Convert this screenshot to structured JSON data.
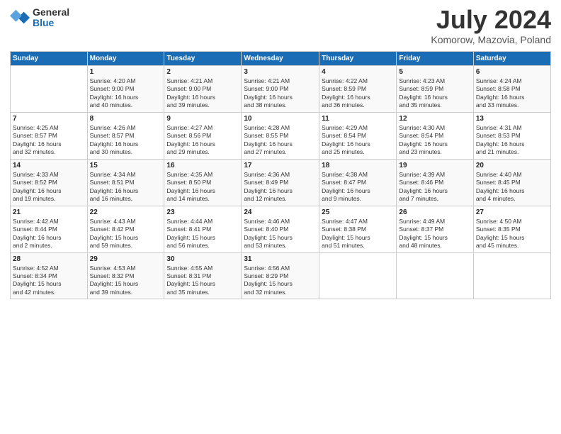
{
  "logo": {
    "general": "General",
    "blue": "Blue"
  },
  "header": {
    "month": "July 2024",
    "location": "Komorow, Mazovia, Poland"
  },
  "weekdays": [
    "Sunday",
    "Monday",
    "Tuesday",
    "Wednesday",
    "Thursday",
    "Friday",
    "Saturday"
  ],
  "weeks": [
    [
      {
        "day": "",
        "info": ""
      },
      {
        "day": "1",
        "info": "Sunrise: 4:20 AM\nSunset: 9:00 PM\nDaylight: 16 hours\nand 40 minutes."
      },
      {
        "day": "2",
        "info": "Sunrise: 4:21 AM\nSunset: 9:00 PM\nDaylight: 16 hours\nand 39 minutes."
      },
      {
        "day": "3",
        "info": "Sunrise: 4:21 AM\nSunset: 9:00 PM\nDaylight: 16 hours\nand 38 minutes."
      },
      {
        "day": "4",
        "info": "Sunrise: 4:22 AM\nSunset: 8:59 PM\nDaylight: 16 hours\nand 36 minutes."
      },
      {
        "day": "5",
        "info": "Sunrise: 4:23 AM\nSunset: 8:59 PM\nDaylight: 16 hours\nand 35 minutes."
      },
      {
        "day": "6",
        "info": "Sunrise: 4:24 AM\nSunset: 8:58 PM\nDaylight: 16 hours\nand 33 minutes."
      }
    ],
    [
      {
        "day": "7",
        "info": "Sunrise: 4:25 AM\nSunset: 8:57 PM\nDaylight: 16 hours\nand 32 minutes."
      },
      {
        "day": "8",
        "info": "Sunrise: 4:26 AM\nSunset: 8:57 PM\nDaylight: 16 hours\nand 30 minutes."
      },
      {
        "day": "9",
        "info": "Sunrise: 4:27 AM\nSunset: 8:56 PM\nDaylight: 16 hours\nand 29 minutes."
      },
      {
        "day": "10",
        "info": "Sunrise: 4:28 AM\nSunset: 8:55 PM\nDaylight: 16 hours\nand 27 minutes."
      },
      {
        "day": "11",
        "info": "Sunrise: 4:29 AM\nSunset: 8:54 PM\nDaylight: 16 hours\nand 25 minutes."
      },
      {
        "day": "12",
        "info": "Sunrise: 4:30 AM\nSunset: 8:54 PM\nDaylight: 16 hours\nand 23 minutes."
      },
      {
        "day": "13",
        "info": "Sunrise: 4:31 AM\nSunset: 8:53 PM\nDaylight: 16 hours\nand 21 minutes."
      }
    ],
    [
      {
        "day": "14",
        "info": "Sunrise: 4:33 AM\nSunset: 8:52 PM\nDaylight: 16 hours\nand 19 minutes."
      },
      {
        "day": "15",
        "info": "Sunrise: 4:34 AM\nSunset: 8:51 PM\nDaylight: 16 hours\nand 16 minutes."
      },
      {
        "day": "16",
        "info": "Sunrise: 4:35 AM\nSunset: 8:50 PM\nDaylight: 16 hours\nand 14 minutes."
      },
      {
        "day": "17",
        "info": "Sunrise: 4:36 AM\nSunset: 8:49 PM\nDaylight: 16 hours\nand 12 minutes."
      },
      {
        "day": "18",
        "info": "Sunrise: 4:38 AM\nSunset: 8:47 PM\nDaylight: 16 hours\nand 9 minutes."
      },
      {
        "day": "19",
        "info": "Sunrise: 4:39 AM\nSunset: 8:46 PM\nDaylight: 16 hours\nand 7 minutes."
      },
      {
        "day": "20",
        "info": "Sunrise: 4:40 AM\nSunset: 8:45 PM\nDaylight: 16 hours\nand 4 minutes."
      }
    ],
    [
      {
        "day": "21",
        "info": "Sunrise: 4:42 AM\nSunset: 8:44 PM\nDaylight: 16 hours\nand 2 minutes."
      },
      {
        "day": "22",
        "info": "Sunrise: 4:43 AM\nSunset: 8:42 PM\nDaylight: 15 hours\nand 59 minutes."
      },
      {
        "day": "23",
        "info": "Sunrise: 4:44 AM\nSunset: 8:41 PM\nDaylight: 15 hours\nand 56 minutes."
      },
      {
        "day": "24",
        "info": "Sunrise: 4:46 AM\nSunset: 8:40 PM\nDaylight: 15 hours\nand 53 minutes."
      },
      {
        "day": "25",
        "info": "Sunrise: 4:47 AM\nSunset: 8:38 PM\nDaylight: 15 hours\nand 51 minutes."
      },
      {
        "day": "26",
        "info": "Sunrise: 4:49 AM\nSunset: 8:37 PM\nDaylight: 15 hours\nand 48 minutes."
      },
      {
        "day": "27",
        "info": "Sunrise: 4:50 AM\nSunset: 8:35 PM\nDaylight: 15 hours\nand 45 minutes."
      }
    ],
    [
      {
        "day": "28",
        "info": "Sunrise: 4:52 AM\nSunset: 8:34 PM\nDaylight: 15 hours\nand 42 minutes."
      },
      {
        "day": "29",
        "info": "Sunrise: 4:53 AM\nSunset: 8:32 PM\nDaylight: 15 hours\nand 39 minutes."
      },
      {
        "day": "30",
        "info": "Sunrise: 4:55 AM\nSunset: 8:31 PM\nDaylight: 15 hours\nand 35 minutes."
      },
      {
        "day": "31",
        "info": "Sunrise: 4:56 AM\nSunset: 8:29 PM\nDaylight: 15 hours\nand 32 minutes."
      },
      {
        "day": "",
        "info": ""
      },
      {
        "day": "",
        "info": ""
      },
      {
        "day": "",
        "info": ""
      }
    ]
  ]
}
